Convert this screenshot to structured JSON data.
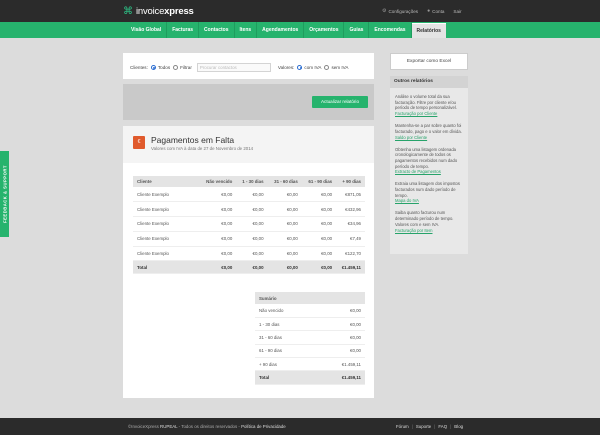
{
  "brand": {
    "name_light": "invoice",
    "name_bold": "xpress"
  },
  "topbar": {
    "items": [
      {
        "icon": "gear-icon",
        "label": "Configurações"
      },
      {
        "icon": "user-icon",
        "label": "Conta"
      },
      {
        "label": "Sair"
      }
    ]
  },
  "nav": {
    "items": [
      "Visão Global",
      "Facturas",
      "Contactos",
      "Itens",
      "Agendamentos",
      "Orçamentos",
      "Guias",
      "Encomendas",
      "Relatórios"
    ],
    "active": "Relatórios"
  },
  "filter": {
    "clients_label": "Clientes:",
    "opt_all": "Todos",
    "opt_filter": "Filtrar",
    "search_placeholder": "Procurar contactos",
    "values_label": "Valores:",
    "opt_with_vat": "com IVA",
    "opt_without_vat": "sem IVA"
  },
  "actions": {
    "update_button": "Actualizar relatório"
  },
  "report": {
    "badge": "€",
    "title": "Pagamentos em Falta",
    "subtitle": "Valores com IVA à data de 27 de Novembro de 2014",
    "columns": [
      "Cliente",
      "Não vencido",
      "1 - 30 dias",
      "31 - 60 dias",
      "61 - 90 dias",
      "+ 90 dias"
    ],
    "rows": [
      {
        "client": "Cliente Exemplo",
        "not_due": "€0,00",
        "d1_30": "€0,00",
        "d31_60": "€0,00",
        "d61_90": "€0,00",
        "d90p": "€871,05"
      },
      {
        "client": "Cliente Exemplo",
        "not_due": "€0,00",
        "d1_30": "€0,00",
        "d31_60": "€0,00",
        "d61_90": "€0,00",
        "d90p": "€432,96"
      },
      {
        "client": "Cliente Exemplo",
        "not_due": "€0,00",
        "d1_30": "€0,00",
        "d31_60": "€0,00",
        "d61_90": "€0,00",
        "d90p": "€34,96"
      },
      {
        "client": "Cliente Exemplo",
        "not_due": "€0,00",
        "d1_30": "€0,00",
        "d31_60": "€0,00",
        "d61_90": "€0,00",
        "d90p": "€7,49"
      },
      {
        "client": "Cliente Exemplo",
        "not_due": "€0,00",
        "d1_30": "€0,00",
        "d31_60": "€0,00",
        "d61_90": "€0,00",
        "d90p": "€122,70"
      }
    ],
    "total": {
      "label": "Total",
      "not_due": "€0,00",
      "d1_30": "€0,00",
      "d31_60": "€0,00",
      "d61_90": "€0,00",
      "d90p": "€1.459,11"
    },
    "summary": {
      "header": "Sumário",
      "rows": [
        {
          "label": "Não vencido",
          "value": "€0,00"
        },
        {
          "label": "1 - 30 dias",
          "value": "€0,00"
        },
        {
          "label": "31 - 60 dias",
          "value": "€0,00"
        },
        {
          "label": "61 - 90 dias",
          "value": "€0,00"
        },
        {
          "label": "+ 90 dias",
          "value": "€1.459,11"
        }
      ],
      "total_label": "Total",
      "total_value": "€1.459,11"
    }
  },
  "sidebar": {
    "export_button": "Exportar como Excel",
    "other_title": "Outros relatórios",
    "reports": [
      {
        "desc": "Análise o volume total da sua facturação. Filtre por cliente e/ou período de tempo personalizável.",
        "link": "Facturação por Cliente"
      },
      {
        "desc": "Mantenha-se a par sobre quanto foi facturado, pago e o valor em dívida.",
        "link": "Saldo por Cliente"
      },
      {
        "desc": "Obtenha uma listagem ordenada cronologicamente de todos os pagamentos recebidos num dado período de tempo.",
        "link": "Extracto de Pagamentos"
      },
      {
        "desc": "Extraia uma listagem dos impostos facturados num dado período de tempo.",
        "link": "Mapa do IVA"
      },
      {
        "desc": "Saiba quanto facturou num determinado período de tempo. Valores com e sem IVA.",
        "link": "Facturação por Item"
      }
    ]
  },
  "feedback": {
    "label": "FEEDBACK & SUPPORT"
  },
  "footer": {
    "copyright_brand": "©InvoiceXpress",
    "copyright_company": "RUPEAL",
    "copyright_rest": " - Todos os direitos reservados - ",
    "privacy": "Política de Privacidade",
    "links": [
      "Fórum",
      "Suporte",
      "FAQ",
      "Blog"
    ]
  },
  "colors": {
    "brand_green": "#26b36d",
    "dark": "#2b2b2b",
    "badge_orange": "#e05a2c"
  }
}
